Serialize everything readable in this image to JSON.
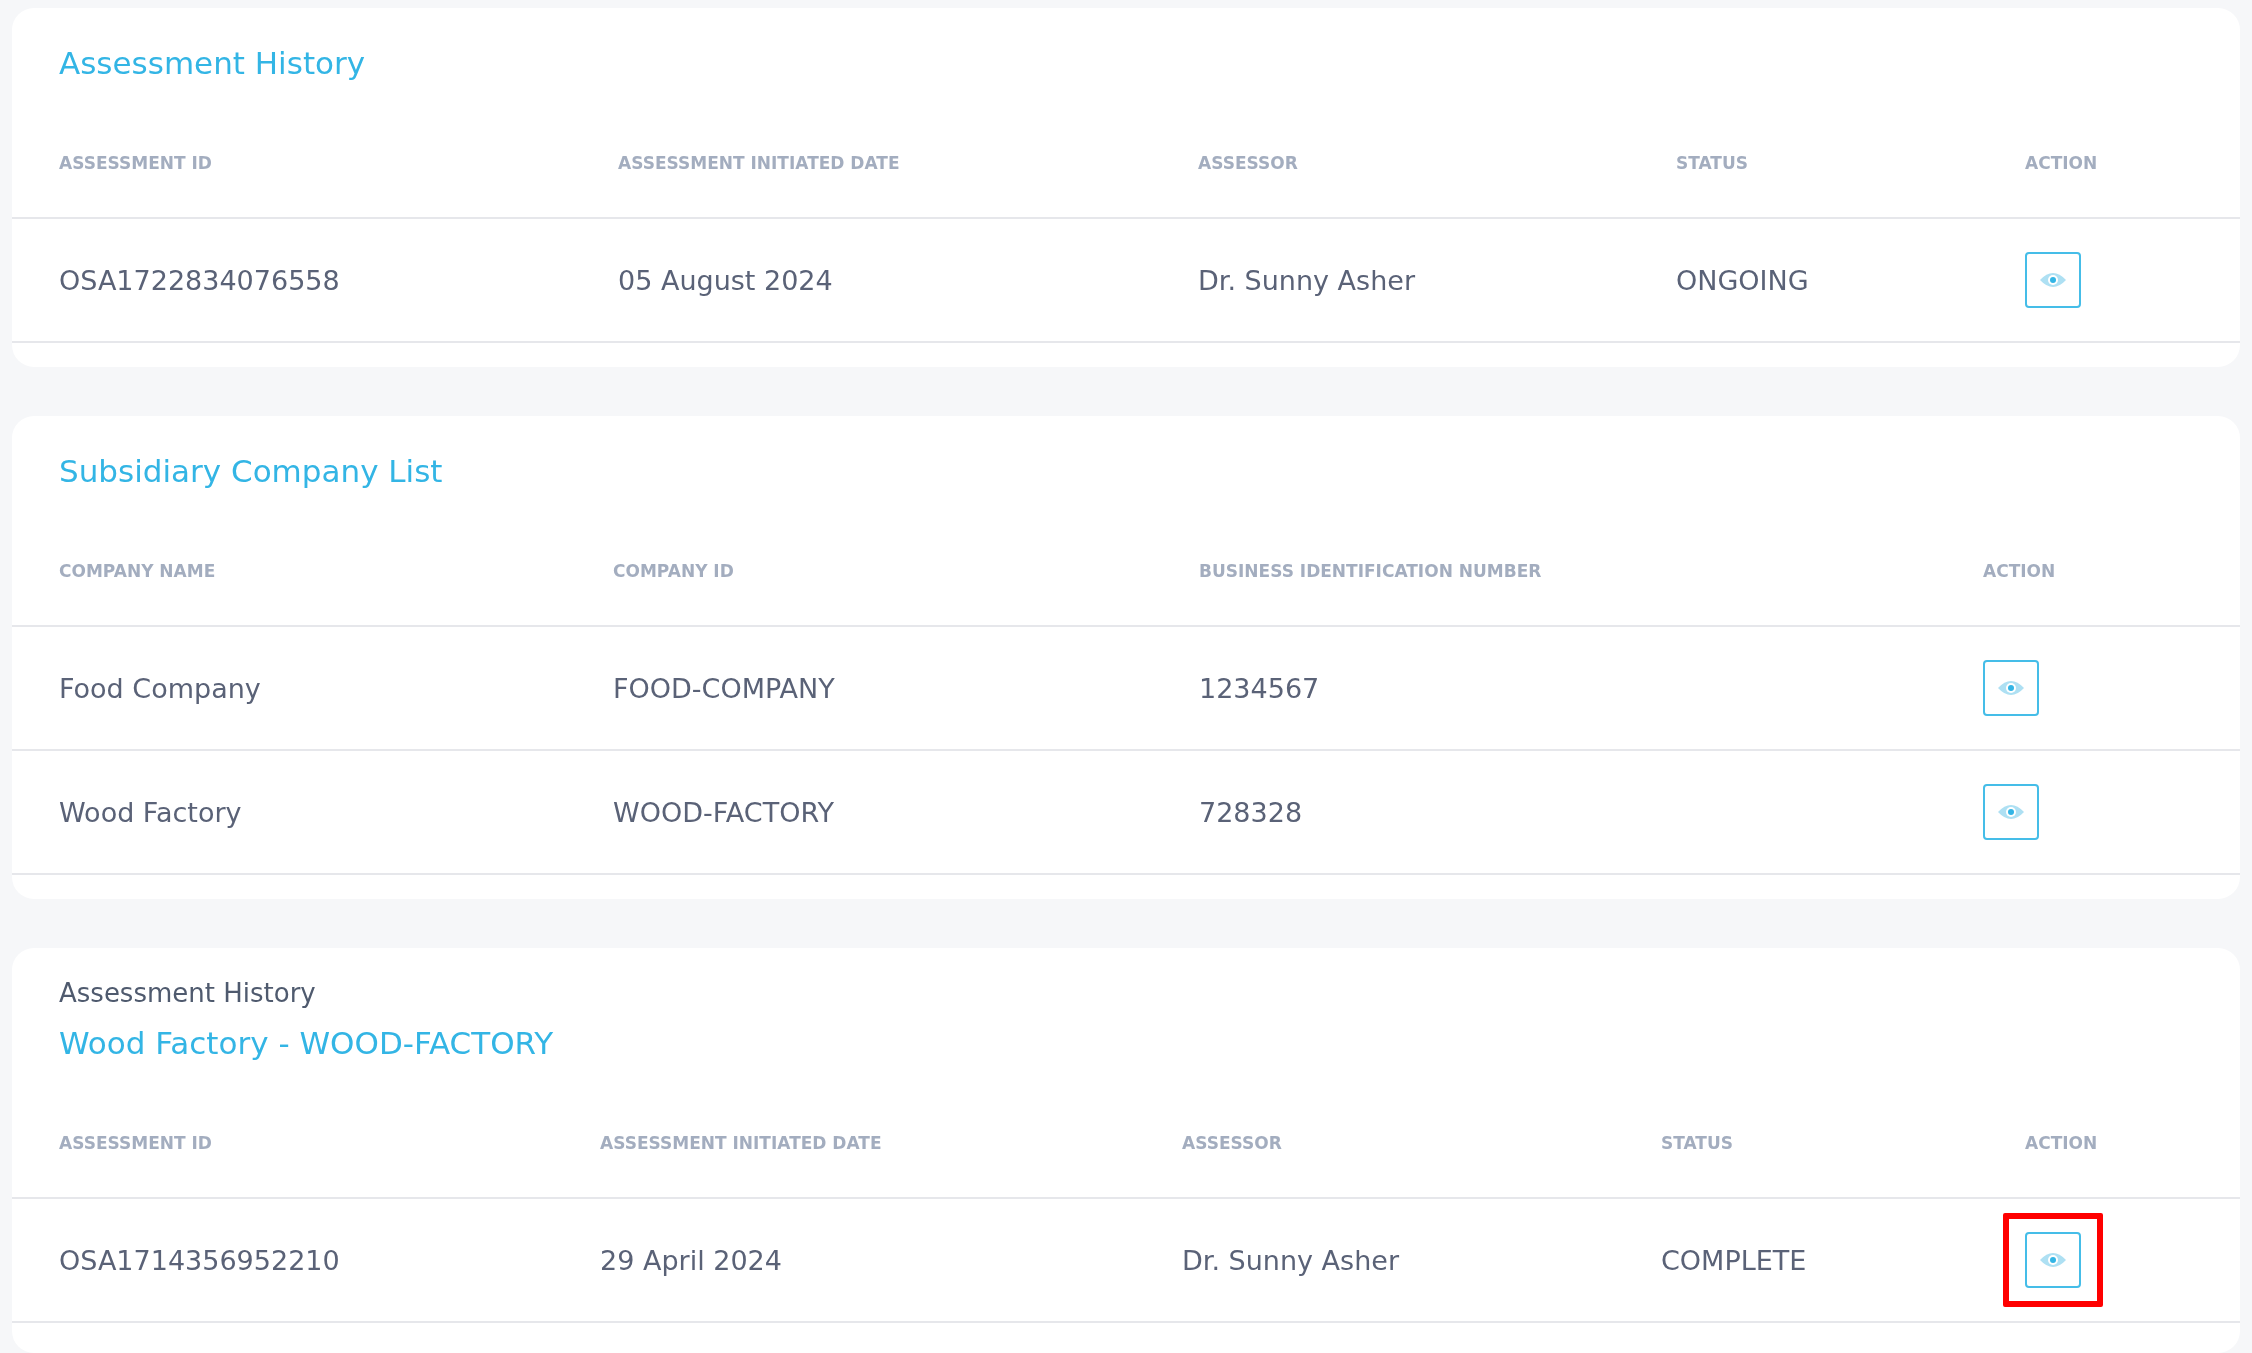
{
  "sections": [
    {
      "title": "Assessment History",
      "columns": [
        "ASSESSMENT ID",
        "ASSESSMENT INITIATED DATE",
        "ASSESSOR",
        "STATUS",
        "ACTION"
      ],
      "rows": [
        {
          "cells": [
            "OSA1722834076558",
            "05 August 2024",
            "Dr. Sunny Asher",
            "ONGOING"
          ],
          "highlighted": false
        }
      ]
    },
    {
      "title": "Subsidiary Company List",
      "columns": [
        "COMPANY NAME",
        "COMPANY ID",
        "BUSINESS IDENTIFICATION NUMBER",
        "ACTION"
      ],
      "rows": [
        {
          "cells": [
            "Food Company",
            "FOOD-COMPANY",
            "1234567"
          ],
          "highlighted": false
        },
        {
          "cells": [
            "Wood Factory",
            "WOOD-FACTORY",
            "728328"
          ],
          "highlighted": false
        }
      ]
    },
    {
      "overline": "Assessment History",
      "title": "Wood Factory - WOOD-FACTORY",
      "columns": [
        "ASSESSMENT ID",
        "ASSESSMENT INITIATED DATE",
        "ASSESSOR",
        "STATUS",
        "ACTION"
      ],
      "rows": [
        {
          "cells": [
            "OSA1714356952210",
            "29 April 2024",
            "Dr. Sunny Asher",
            "COMPLETE"
          ],
          "highlighted": true
        }
      ]
    }
  ]
}
